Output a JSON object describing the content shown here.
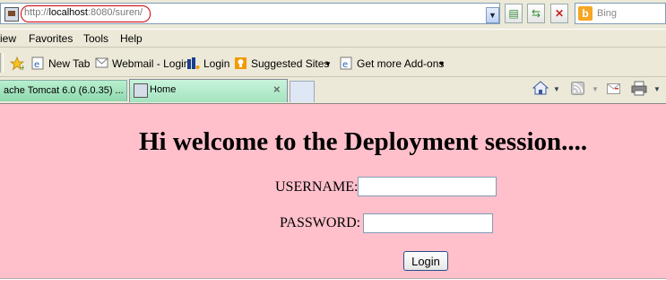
{
  "address_bar": {
    "url_scheme": "http://",
    "url_host": "localhost",
    "url_rest": ":8080/suren/"
  },
  "search": {
    "placeholder": "Bing"
  },
  "menu": {
    "items": [
      "iew",
      "Favorites",
      "Tools",
      "Help"
    ]
  },
  "bookmarks": {
    "items": [
      "New Tab",
      "Webmail - Login",
      "Login",
      "Suggested Sites",
      "Get more Add-ons"
    ]
  },
  "tabs": [
    {
      "label": "ache Tomcat 6.0 (6.0.35) ..."
    },
    {
      "label": "Home"
    }
  ],
  "page": {
    "heading": "Hi welcome to the Deployment session....",
    "username_label": "USERNAME:",
    "password_label": "PASSWORD:",
    "login_label": "Login",
    "background": "#ffc0cb"
  },
  "icons": {
    "favicon": "page-icon",
    "compat": "compatibility-view-icon",
    "refresh": "refresh-icon",
    "stop": "stop-icon",
    "search_provider": "bing-icon",
    "home": "home-icon",
    "feeds": "feeds-icon",
    "mail": "mail-icon",
    "print": "print-icon"
  }
}
